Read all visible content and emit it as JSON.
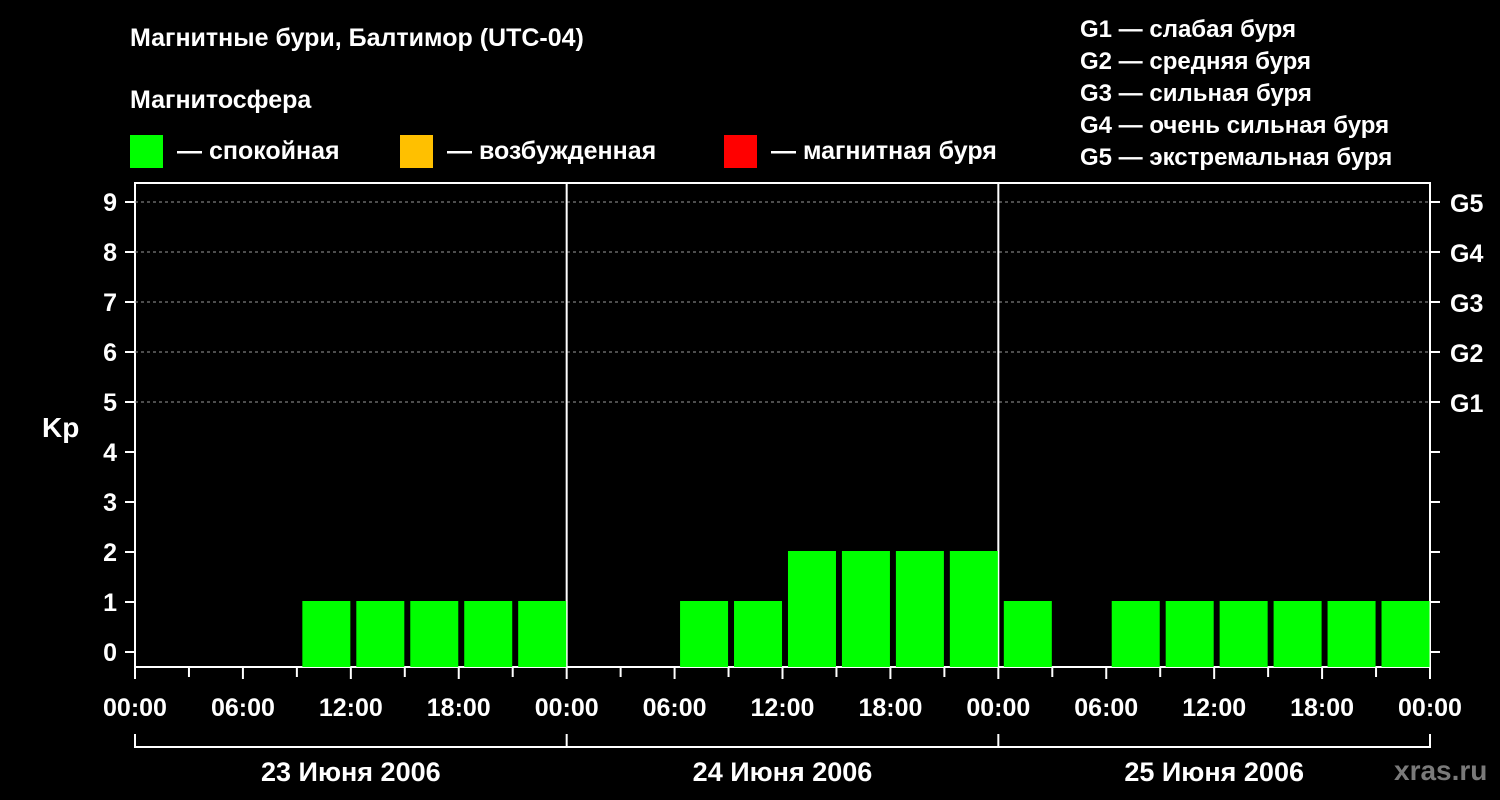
{
  "title": "Магнитные бури, Балтимор (UTC-04)",
  "magnetosphere_label": "Магнитосфера",
  "legend": [
    {
      "color": "#00ff00",
      "label": "— спокойная"
    },
    {
      "color": "#ffc000",
      "label": "— возбужденная"
    },
    {
      "color": "#ff0000",
      "label": "— магнитная буря"
    }
  ],
  "g_scale": [
    "G1 — слабая буря",
    "G2 — средняя буря",
    "G3 — сильная буря",
    "G4 — очень сильная буря",
    "G5 — экстремальная буря"
  ],
  "watermark": "xras.ru",
  "chart_data": {
    "type": "bar",
    "ylabel": "Kp",
    "ylim": [
      0,
      9
    ],
    "y_ticks": [
      "0",
      "1",
      "2",
      "3",
      "4",
      "5",
      "6",
      "7",
      "8",
      "9"
    ],
    "g_levels": [
      {
        "kp": 5,
        "label": "G1"
      },
      {
        "kp": 6,
        "label": "G2"
      },
      {
        "kp": 7,
        "label": "G3"
      },
      {
        "kp": 8,
        "label": "G4"
      },
      {
        "kp": 9,
        "label": "G5"
      }
    ],
    "x_tick_labels": [
      "00:00",
      "06:00",
      "12:00",
      "18:00",
      "00:00",
      "06:00",
      "12:00",
      "18:00",
      "00:00",
      "06:00",
      "12:00",
      "18:00",
      "00:00"
    ],
    "days": [
      "23 Июня 2006",
      "24 Июня 2006",
      "25 Июня 2006"
    ],
    "interval_hours": 3,
    "kp_values": [
      [
        0,
        0,
        0,
        1,
        1,
        1,
        1,
        1
      ],
      [
        0,
        0,
        1,
        1,
        2,
        2,
        2,
        2
      ],
      [
        1,
        0,
        1,
        1,
        1,
        1,
        1,
        1
      ]
    ],
    "bar_color": "#00ff00",
    "grid": true
  }
}
